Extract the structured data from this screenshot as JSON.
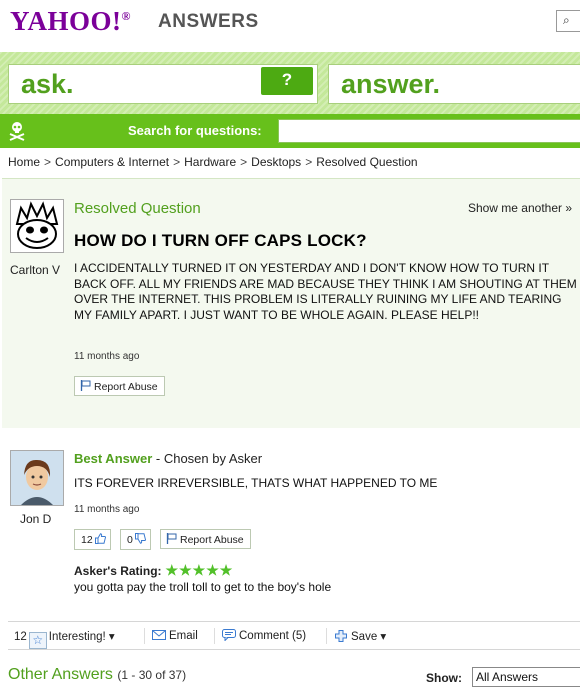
{
  "header": {
    "logo_text": "YAHOO!",
    "logo_suffix": "ANSWERS"
  },
  "ask_band": {
    "ask_label": "ask.",
    "ask_icon": "?",
    "answer_label": "answer."
  },
  "search": {
    "label": "Search for questions:",
    "value": ""
  },
  "breadcrumb": [
    "Home",
    "Computers & Internet",
    "Hardware",
    "Desktops",
    "Resolved Question"
  ],
  "question": {
    "status": "Resolved Question",
    "show_another": "Show me another »",
    "title": "HOW DO I TURN OFF CAPS LOCK?",
    "body": "I ACCIDENTALLY TURNED IT ON YESTERDAY AND I DON'T KNOW HOW TO TURN IT BACK OFF. ALL MY FRIENDS ARE MAD BECAUSE THEY THINK I AM SHOUTING AT THEM OVER THE INTERNET. THIS PROBLEM IS LITERALLY RUINING MY LIFE AND TEARING MY FAMILY APART. I JUST WANT TO BE WHOLE AGAIN. PLEASE HELP!!",
    "time": "11 months ago",
    "report_label": "Report Abuse",
    "asker": "Carlton V"
  },
  "best_answer": {
    "label": "Best Answer",
    "chosen_by": " - Chosen by Asker",
    "body": "ITS FOREVER IRREVERSIBLE, THATS WHAT HAPPENED TO ME",
    "time": "11 months ago",
    "thumbs_up": "12",
    "thumbs_down": "0",
    "report_label": "Report Abuse",
    "answerer": "Jon D",
    "rating_label": "Asker's Rating:",
    "rating_stars": "★★★★★",
    "rating_comment": "you gotta pay the troll toll to get to the boy's hole"
  },
  "actions": {
    "star_count": "12",
    "interesting": "Interesting! ▾",
    "email": "Email",
    "comment": "Comment (5)",
    "save": "Save ▾"
  },
  "other_answers": {
    "title": "Other Answers",
    "count": "(1 - 30 of 37)",
    "show_label": "Show:",
    "show_value": "All Answers"
  },
  "colors": {
    "brand_purple": "#7b0099",
    "brand_green": "#52a01e",
    "search_bar": "#67c01b"
  }
}
